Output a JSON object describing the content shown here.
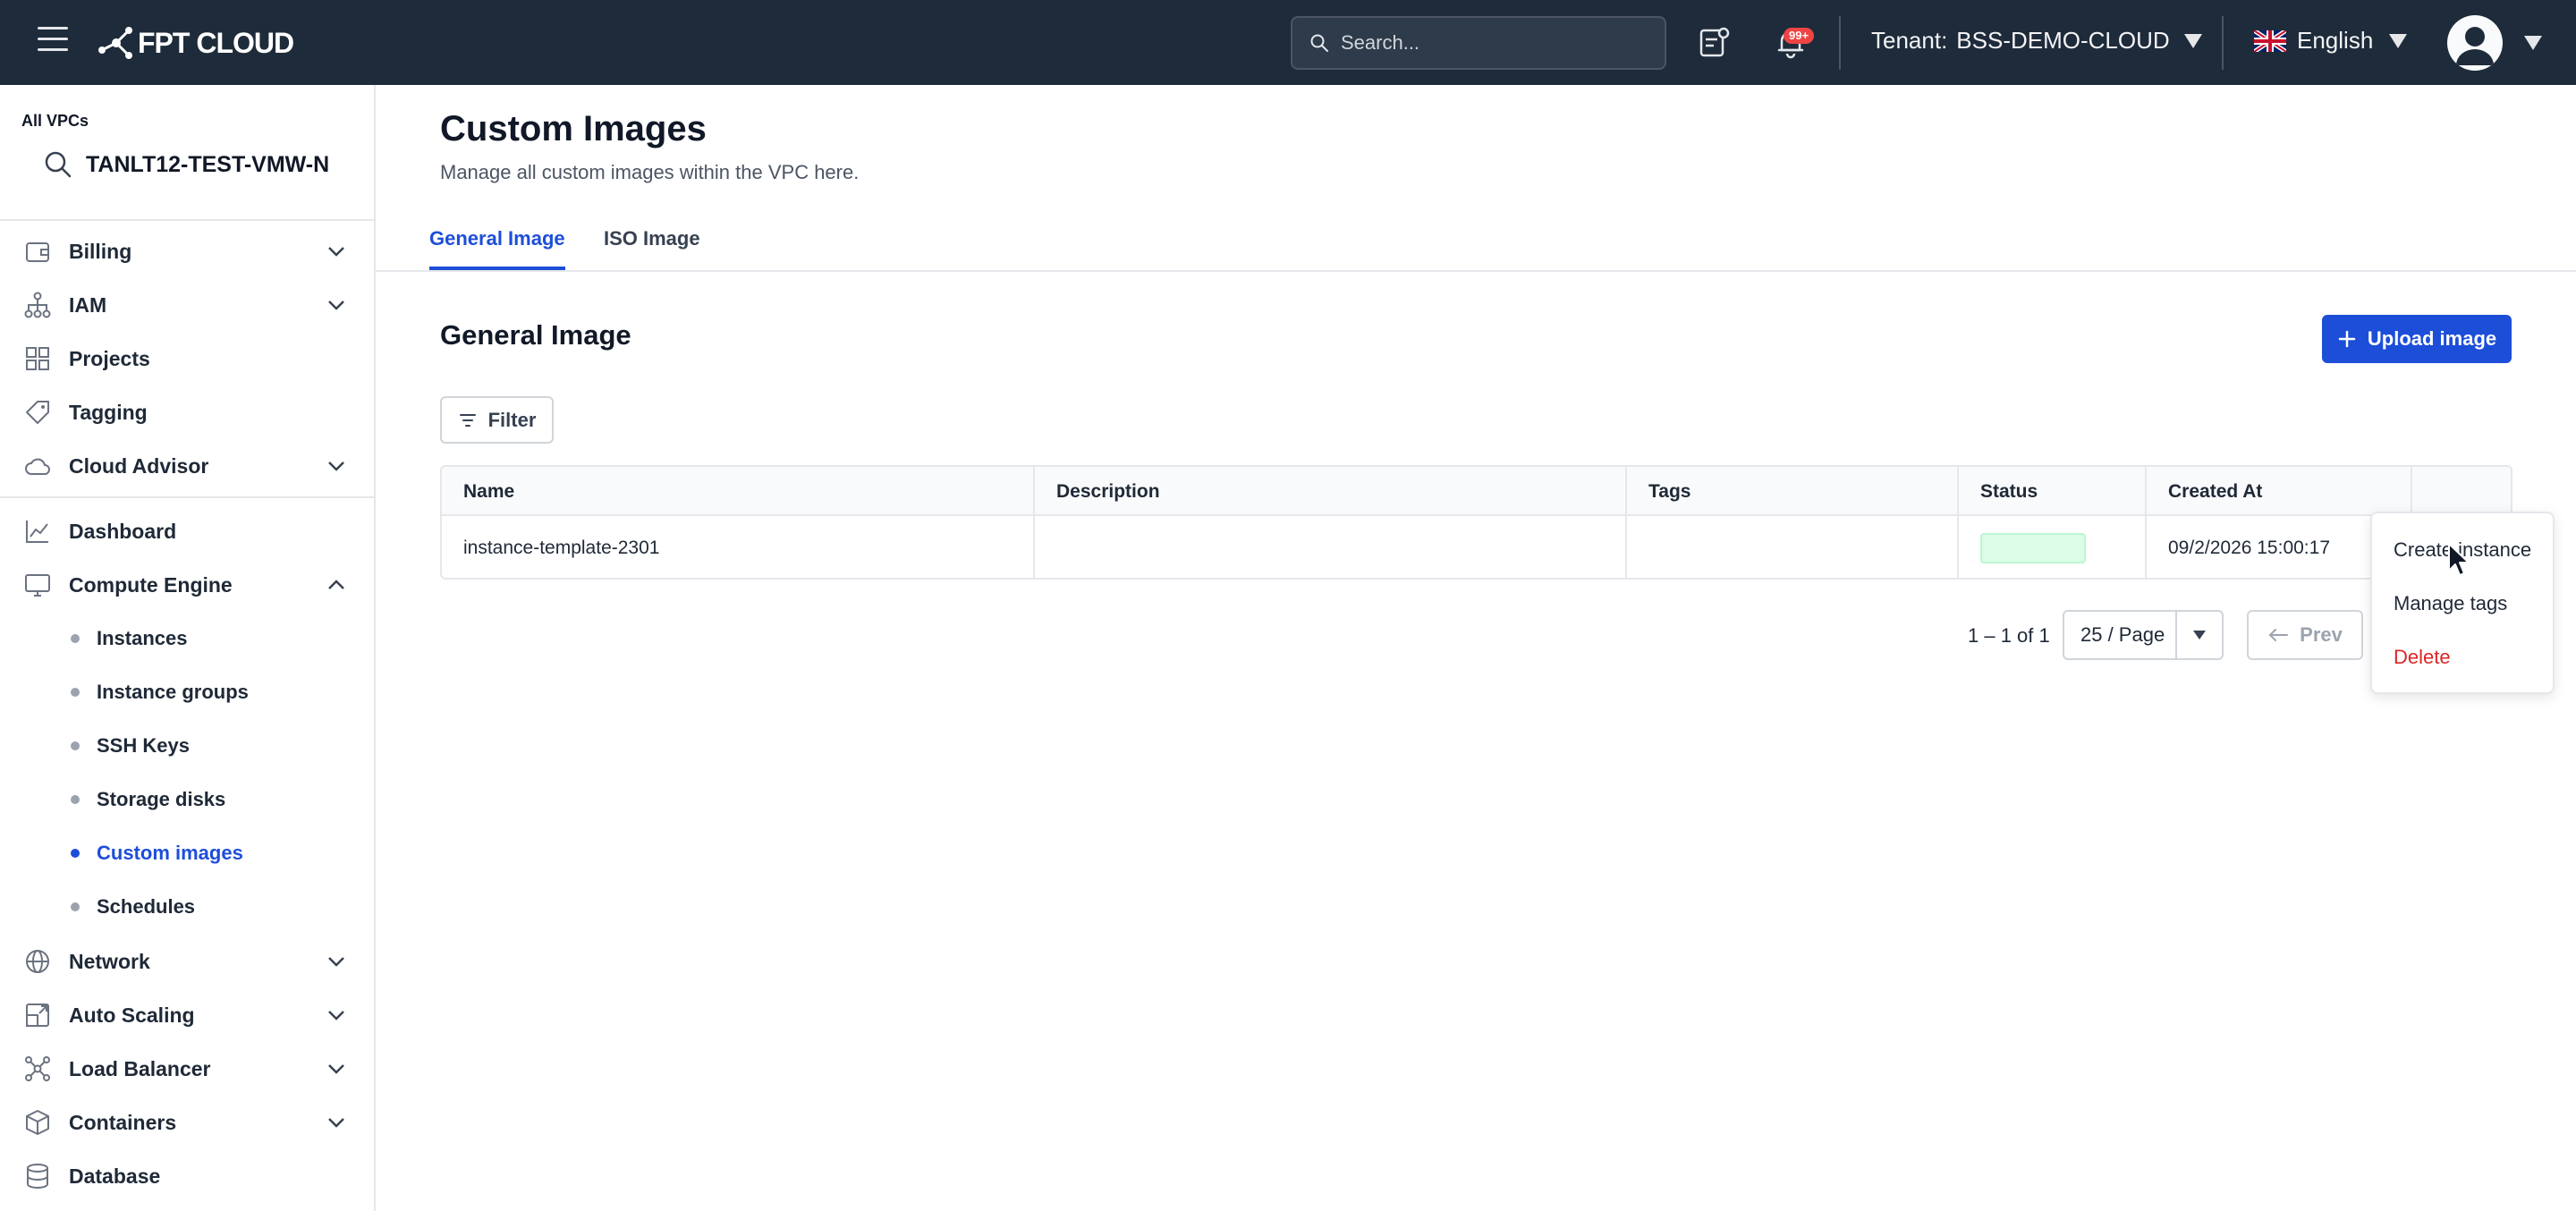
{
  "header": {
    "logo_text": "FPT CLOUD",
    "search_placeholder": "Search...",
    "notification_badge": "99+",
    "tenant_label": "Tenant:",
    "tenant_value": "BSS-DEMO-CLOUD",
    "language": "English"
  },
  "sidebar": {
    "vpc_label": "All VPCs",
    "vpc_name": "TANLT12-TEST-VMW-N",
    "items": [
      {
        "label": "Billing",
        "icon": "wallet-icon",
        "expandable": true
      },
      {
        "label": "IAM",
        "icon": "hierarchy-icon",
        "expandable": true
      },
      {
        "label": "Projects",
        "icon": "grid-icon",
        "expandable": false
      },
      {
        "label": "Tagging",
        "icon": "tag-icon",
        "expandable": false
      },
      {
        "label": "Cloud Advisor",
        "icon": "cloud-icon",
        "expandable": true
      },
      {
        "label": "Dashboard",
        "icon": "chart-icon",
        "expandable": false
      },
      {
        "label": "Compute Engine",
        "icon": "monitor-icon",
        "expandable": true,
        "expanded": true
      },
      {
        "label": "Network",
        "icon": "globe-icon",
        "expandable": true
      },
      {
        "label": "Auto Scaling",
        "icon": "scale-icon",
        "expandable": true
      },
      {
        "label": "Load Balancer",
        "icon": "network-icon",
        "expandable": true
      },
      {
        "label": "Containers",
        "icon": "box-icon",
        "expandable": true
      },
      {
        "label": "Database",
        "icon": "database-icon",
        "expandable": false
      }
    ],
    "compute_sub_items": [
      {
        "label": "Instances",
        "active": false
      },
      {
        "label": "Instance groups",
        "active": false
      },
      {
        "label": "SSH Keys",
        "active": false
      },
      {
        "label": "Storage disks",
        "active": false
      },
      {
        "label": "Custom images",
        "active": true
      },
      {
        "label": "Schedules",
        "active": false
      }
    ]
  },
  "main": {
    "title": "Custom Images",
    "subtitle": "Manage all custom images within the VPC here.",
    "tabs": [
      {
        "label": "General Image",
        "active": true
      },
      {
        "label": "ISO Image",
        "active": false
      }
    ],
    "section_title": "General Image",
    "upload_button": "Upload image",
    "filter_button": "Filter",
    "table": {
      "columns": [
        "Name",
        "Description",
        "Tags",
        "Status",
        "Created At",
        ""
      ],
      "rows": [
        {
          "name": "instance-template-2301",
          "description": "",
          "tags": "",
          "status": "",
          "created_at": "09/2/2026 15:00:17"
        }
      ]
    },
    "pagination": {
      "range": "1 – 1 of 1",
      "page_size": "25 / Page",
      "prev": "Prev"
    },
    "context_menu": {
      "items": [
        "Create instance",
        "Manage tags",
        "Delete"
      ]
    }
  },
  "colors": {
    "topbar_bg": "#1e2b3a",
    "accent": "#1d4ed8",
    "danger": "#dc2626",
    "status_green": "#dcfce7"
  }
}
